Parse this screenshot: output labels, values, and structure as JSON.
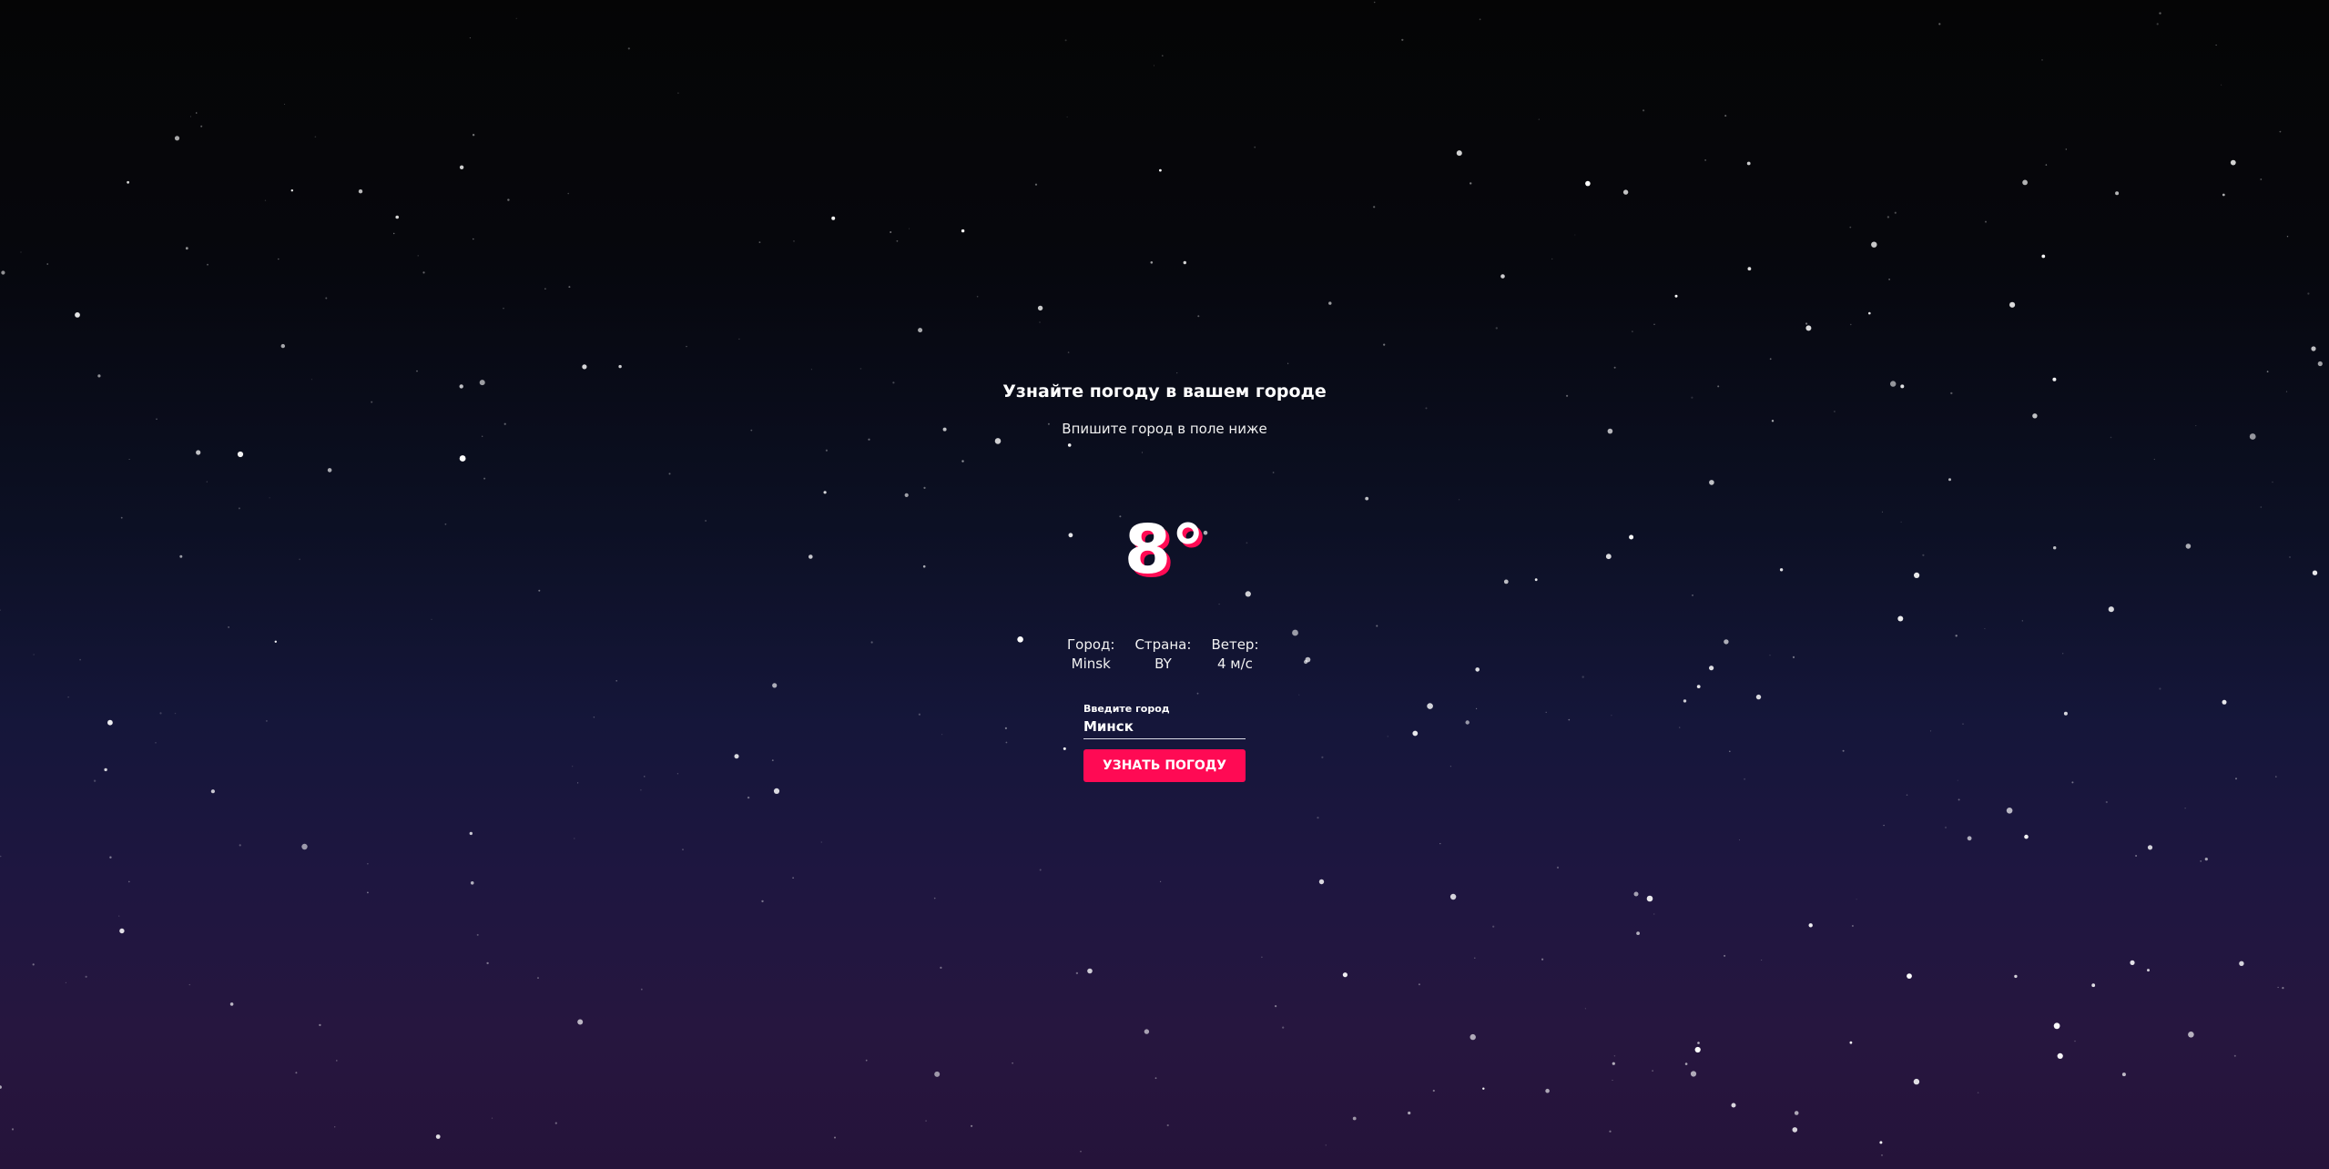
{
  "header": {
    "title": "Узнайте погоду в вашем городе",
    "subtitle": "Впишите город в поле ниже"
  },
  "weather": {
    "temperature": "8°",
    "city_label": "Город:",
    "city_value": "Minsk",
    "country_label": "Страна:",
    "country_value": "BY",
    "wind_label": "Ветер:",
    "wind_value": "4 м/с"
  },
  "form": {
    "input_label": "Введите город",
    "input_value": "Минск",
    "button_label": "УЗНАТЬ ПОГОДУ"
  },
  "colors": {
    "accent": "#ff0a54",
    "text": "#ffffff"
  }
}
